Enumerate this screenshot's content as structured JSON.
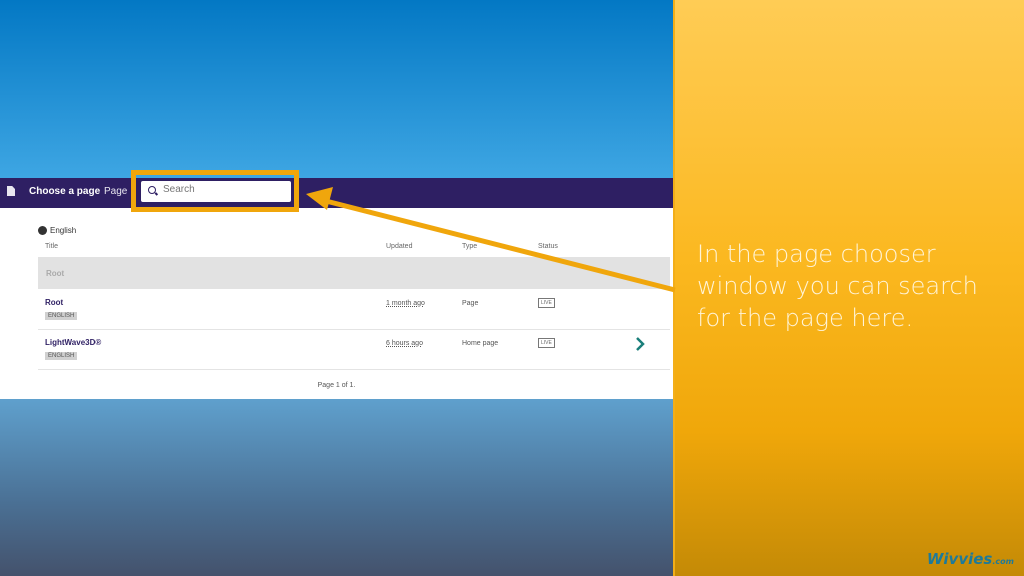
{
  "header": {
    "title": "Choose a page",
    "subtitle": "Page"
  },
  "search": {
    "placeholder": "Search",
    "value": ""
  },
  "locale": "English",
  "table": {
    "columns": [
      "Title",
      "Updated",
      "Type",
      "Status"
    ],
    "parent": "Root",
    "rows": [
      {
        "title": "Root",
        "locale_badge": "ENGLISH",
        "updated": "1 month ago",
        "type": "Page",
        "status": "LIVE"
      },
      {
        "title": "LightWave3D®",
        "locale_badge": "ENGLISH",
        "updated": "6 hours ago",
        "type": "Home page",
        "status": "LIVE"
      }
    ]
  },
  "pagination": "Page 1 of 1.",
  "caption": "In the page chooser window you can search for the page here.",
  "brand": {
    "name": "Wivvies",
    "suffix": ".com"
  },
  "colors": {
    "header": "#2e1f63",
    "highlight": "#f0a60c",
    "chevron": "#1a7f7a"
  }
}
